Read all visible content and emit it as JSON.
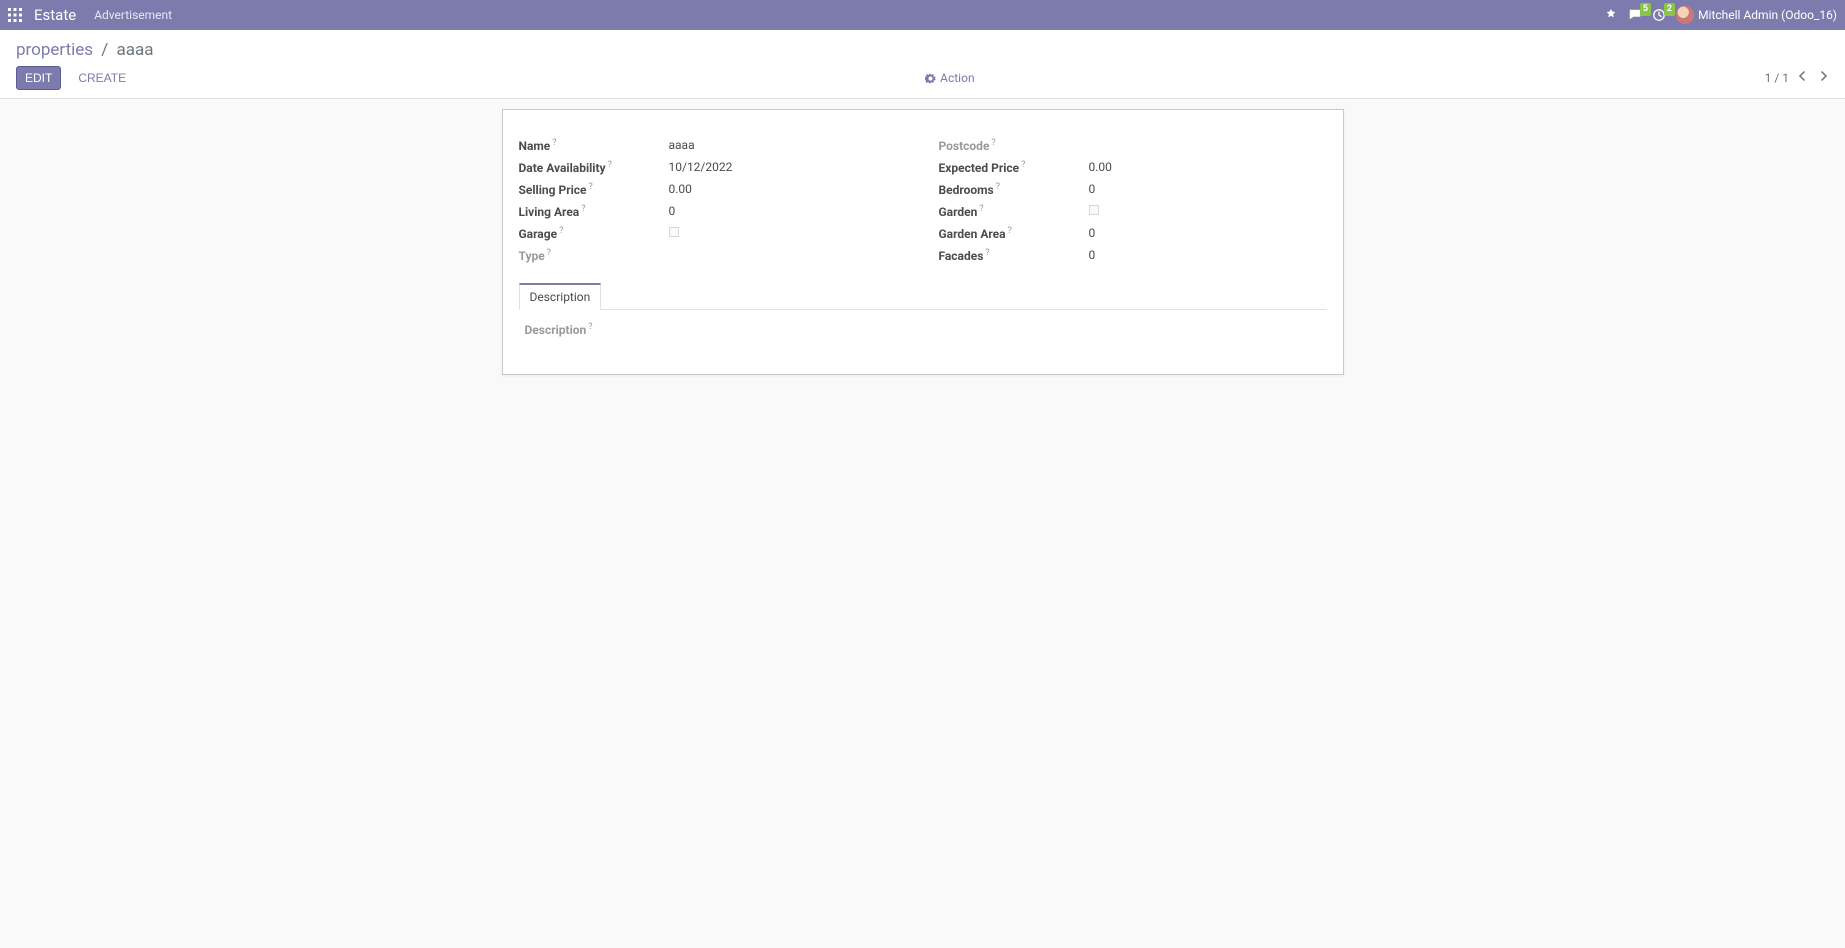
{
  "navbar": {
    "app_name": "Estate",
    "menu_items": [
      "Advertisement"
    ],
    "messaging_badge": "5",
    "activities_badge": "2",
    "user_display": "Mitchell Admin (Odoo_16)"
  },
  "breadcrumbs": {
    "parent": "properties",
    "current": "aaaa"
  },
  "buttons": {
    "edit": "EDIT",
    "create": "CREATE",
    "action": "Action"
  },
  "pager": {
    "text": "1 / 1"
  },
  "fields_left": [
    {
      "label": "Name",
      "value": "aaaa",
      "empty": false
    },
    {
      "label": "Date Availability",
      "value": "10/12/2022",
      "empty": false
    },
    {
      "label": "Selling Price",
      "value": "0.00",
      "empty": false
    },
    {
      "label": "Living Area",
      "value": "0",
      "empty": false
    },
    {
      "label": "Garage",
      "value": "",
      "empty": false,
      "checkbox": true,
      "checked": false
    },
    {
      "label": "Type",
      "value": "",
      "empty": true
    }
  ],
  "fields_right": [
    {
      "label": "Postcode",
      "value": "",
      "empty": true
    },
    {
      "label": "Expected Price",
      "value": "0.00",
      "empty": false
    },
    {
      "label": "Bedrooms",
      "value": "0",
      "empty": false
    },
    {
      "label": "Garden",
      "value": "",
      "empty": false,
      "checkbox": true,
      "checked": false
    },
    {
      "label": "Garden Area",
      "value": "0",
      "empty": false
    },
    {
      "label": "Facades",
      "value": "0",
      "empty": false
    }
  ],
  "notebook": {
    "tabs": [
      {
        "label": "Description",
        "active": true
      }
    ],
    "description_label": "Description",
    "description_value": ""
  },
  "help_marker": "?"
}
